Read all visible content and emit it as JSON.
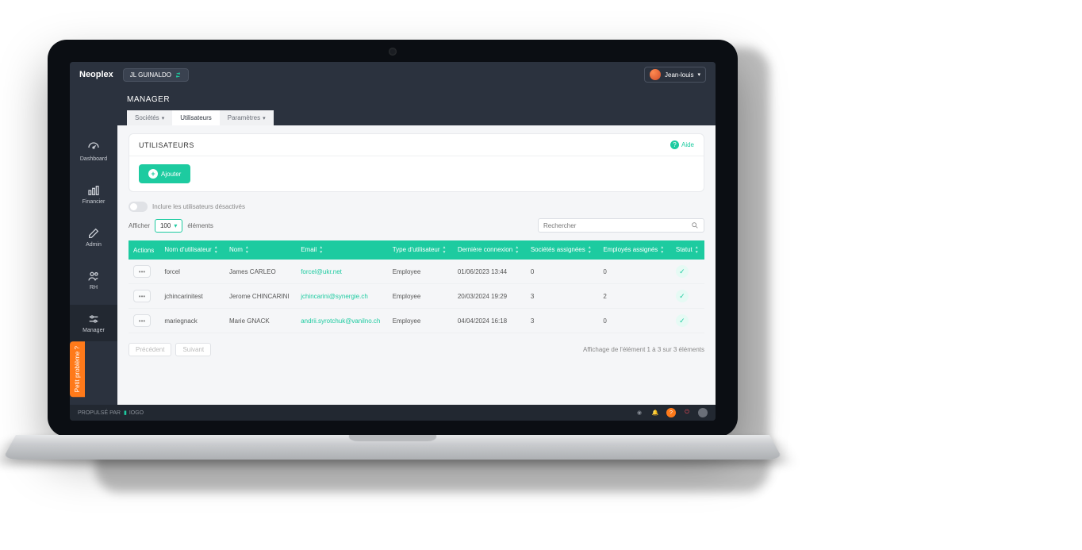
{
  "brand": "Neoplex",
  "org": "JL GUINALDO",
  "user": "Jean-louis",
  "section_title": "MANAGER",
  "tabs": {
    "societes": "Sociétés",
    "utilisateurs": "Utilisateurs",
    "parametres": "Paramètres"
  },
  "sidebar": [
    {
      "label": "Dashboard"
    },
    {
      "label": "Financier"
    },
    {
      "label": "Admin"
    },
    {
      "label": "RH"
    },
    {
      "label": "Manager"
    }
  ],
  "panel": {
    "title": "UTILISATEURS",
    "help": "Aide",
    "add_label": "Ajouter"
  },
  "toggle": "Inclure les utilisateurs désactivés",
  "show": {
    "prefix": "Afficher",
    "value": "100",
    "suffix": "éléments"
  },
  "search_placeholder": "Rechercher",
  "cols": {
    "actions": "Actions",
    "username": "Nom d'utilisateur",
    "name": "Nom",
    "email": "Email",
    "type": "Type d'utilisateur",
    "last": "Dernière connexion",
    "soc": "Sociétés assignées",
    "emp": "Employés assignés",
    "status": "Statut"
  },
  "rows": [
    {
      "username": "forcel",
      "name": "James CARLEO",
      "email": "forcel@ukr.net",
      "type": "Employee",
      "last": "01/06/2023 13:44",
      "soc": "0",
      "emp": "0"
    },
    {
      "username": "jchincarinitest",
      "name": "Jerome CHINCARINI",
      "email": "jchincarini@synergie.ch",
      "type": "Employee",
      "last": "20/03/2024 19:29",
      "soc": "3",
      "emp": "2"
    },
    {
      "username": "mariegnack",
      "name": "Marie GNACK",
      "email": "andrii.syrotchuk@vanilnо.ch",
      "type": "Employee",
      "last": "04/04/2024 16:18",
      "soc": "3",
      "emp": "0"
    }
  ],
  "pager": {
    "prev": "Précédent",
    "next": "Suivant",
    "info": "Affichage de l'élément 1 à 3 sur 3 éléments"
  },
  "footer": {
    "powered": "PROPULSÉ PAR",
    "vendor": "IOGO"
  },
  "feedback": "Petit problème ?"
}
